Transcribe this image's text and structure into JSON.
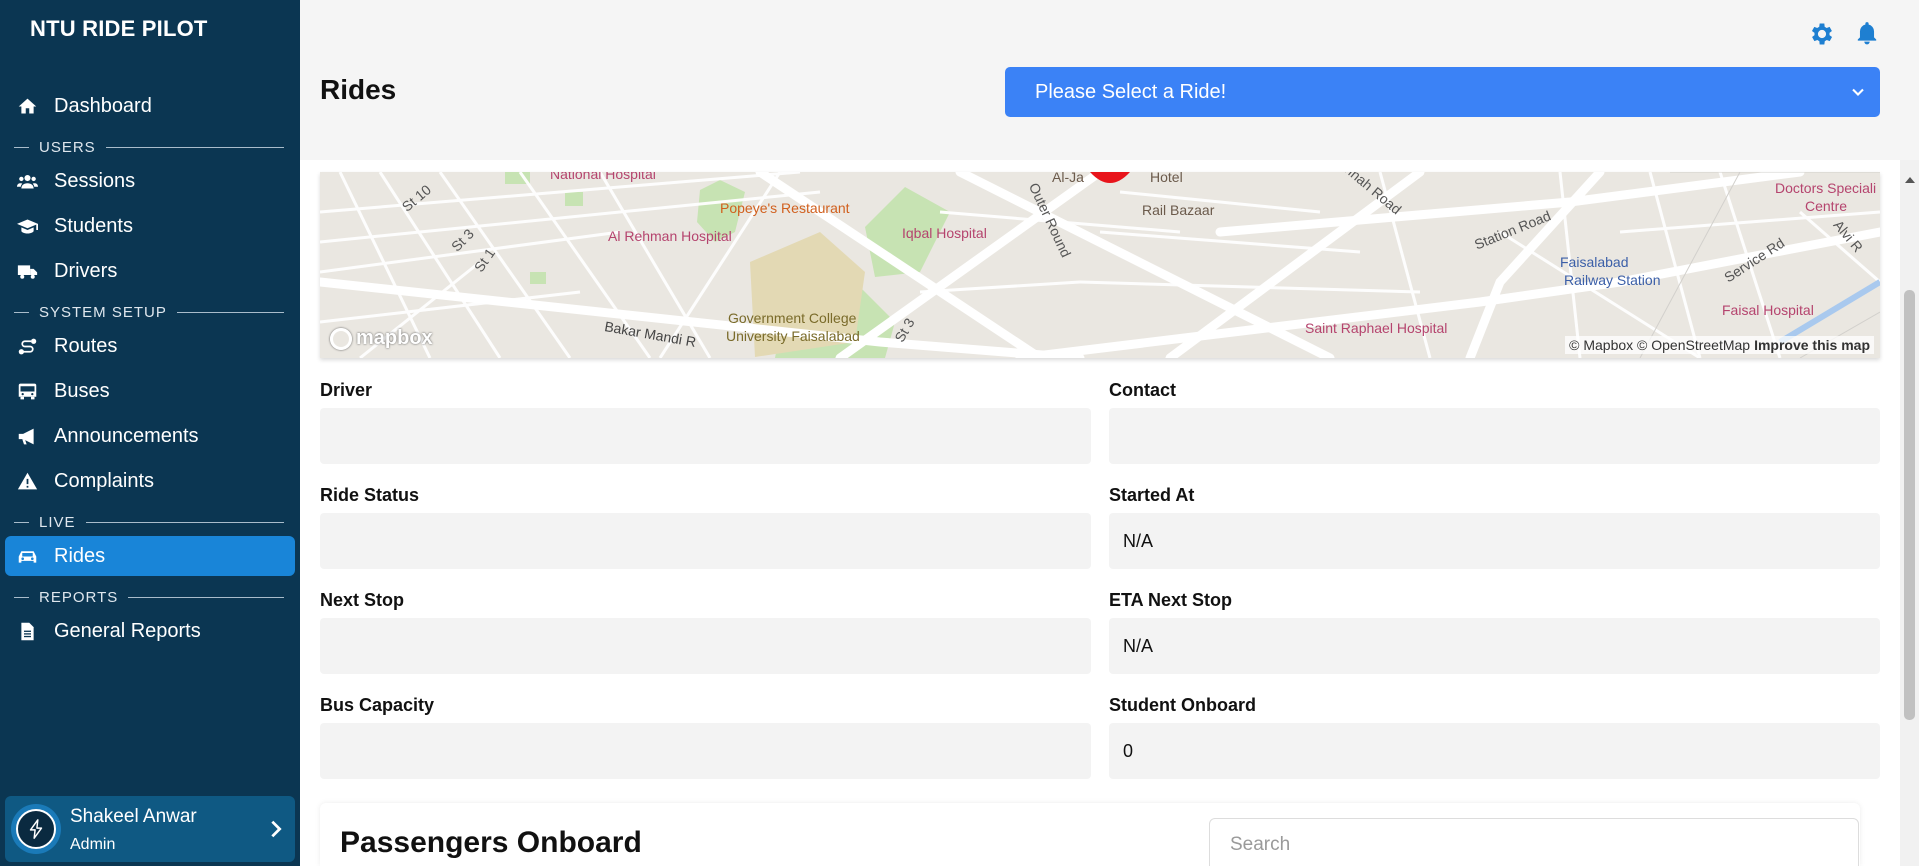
{
  "app": {
    "brand": "NTU RIDE PILOT"
  },
  "sidebar": {
    "items": [
      {
        "label": "Dashboard",
        "icon": "home-icon"
      },
      {
        "label": "Sessions",
        "icon": "users-icon"
      },
      {
        "label": "Students",
        "icon": "graduation-cap-icon"
      },
      {
        "label": "Drivers",
        "icon": "truck-icon"
      },
      {
        "label": "Routes",
        "icon": "route-icon"
      },
      {
        "label": "Buses",
        "icon": "bus-icon"
      },
      {
        "label": "Announcements",
        "icon": "bullhorn-icon"
      },
      {
        "label": "Complaints",
        "icon": "warning-icon"
      },
      {
        "label": "Rides",
        "icon": "car-icon",
        "active": true
      },
      {
        "label": "General Reports",
        "icon": "file-icon"
      }
    ],
    "sections": {
      "users": "USERS",
      "system_setup": "SYSTEM SETUP",
      "live": "LIVE",
      "reports": "REPORTS"
    },
    "profile": {
      "name": "Shakeel Anwar",
      "role": "Admin"
    }
  },
  "header": {
    "title": "Rides",
    "ride_select": "Please Select a Ride!"
  },
  "map": {
    "labels": [
      "National Hospital",
      "Al Rehman Hospital",
      "Popeye's Restaurant",
      "Iqbal Hospital",
      "Government College",
      "University Faisalabad",
      "Al-Ja",
      "Hotel",
      "Rail Bazaar",
      "Outer Round",
      "Jinnah Road",
      "Station Road",
      "Faisalabad",
      "Railway Station",
      "Doctors Speciali",
      "Centre",
      "Service Rd",
      "Alvi R",
      "Faisal Hospital",
      "Saint Raphael Hospital",
      "Bakar Mandi R",
      "St 10",
      "St 3",
      "St 1",
      "St 3"
    ],
    "logo": "mapbox",
    "attribution": "© Mapbox © OpenStreetMap",
    "improve": "Improve this map"
  },
  "fields": {
    "driver": {
      "label": "Driver",
      "value": ""
    },
    "contact": {
      "label": "Contact",
      "value": ""
    },
    "ride_status": {
      "label": "Ride Status",
      "value": ""
    },
    "started_at": {
      "label": "Started At",
      "value": "N/A"
    },
    "next_stop": {
      "label": "Next Stop",
      "value": ""
    },
    "eta_next_stop": {
      "label": "ETA Next Stop",
      "value": "N/A"
    },
    "bus_capacity": {
      "label": "Bus Capacity",
      "value": ""
    },
    "student_onboard": {
      "label": "Student Onboard",
      "value": "0"
    }
  },
  "passengers": {
    "title": "Passengers Onboard",
    "search_placeholder": "Search"
  },
  "colors": {
    "sidebar_bg": "#0b3652",
    "active": "#1985d8",
    "select_bg": "#3b82f6",
    "icon_blue": "#1e7fd1"
  }
}
